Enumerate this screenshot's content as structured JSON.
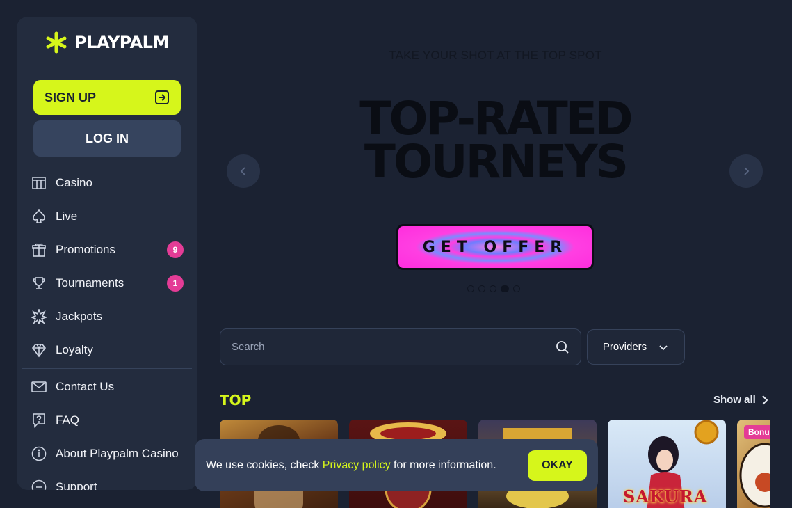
{
  "brand": {
    "name": "PLAYPALM",
    "accent": "#d6f61b"
  },
  "sidebar": {
    "signup_label": "SIGN UP",
    "login_label": "LOG IN",
    "items": [
      {
        "label": "Casino",
        "icon": "casino-icon"
      },
      {
        "label": "Live",
        "icon": "spade-icon"
      },
      {
        "label": "Promotions",
        "icon": "gift-icon",
        "badge": "9"
      },
      {
        "label": "Tournaments",
        "icon": "trophy-icon",
        "badge": "1"
      },
      {
        "label": "Jackpots",
        "icon": "star-burst-icon"
      },
      {
        "label": "Loyalty",
        "icon": "diamond-icon"
      }
    ],
    "secondary": [
      {
        "label": "Contact Us",
        "icon": "mail-icon"
      },
      {
        "label": "FAQ",
        "icon": "question-icon"
      },
      {
        "label": "About Playpalm Casino",
        "icon": "info-icon"
      },
      {
        "label": "Support",
        "icon": "support-icon"
      }
    ]
  },
  "hero": {
    "tagline": "TAKE YOUR SHOT AT THE TOP SPOT",
    "headline_line1": "TOP-RATED",
    "headline_line2": "TOURNEYS",
    "cta": "GET OFFER",
    "slides_total": 5,
    "active_slide": 4
  },
  "search": {
    "placeholder": "Search"
  },
  "providers_label": "Providers",
  "section": {
    "title": "TOP",
    "show_all": "Show all"
  },
  "games": [
    {
      "title": "",
      "badge": ""
    },
    {
      "title": "",
      "badge": ""
    },
    {
      "title": "",
      "badge": ""
    },
    {
      "title": "SAKURA",
      "badge": ""
    },
    {
      "title": "",
      "badge": "Bonus"
    }
  ],
  "cookie": {
    "text_before": "We use cookies, check ",
    "link": "Privacy policy",
    "text_after": " for more information.",
    "button": "OKAY"
  }
}
